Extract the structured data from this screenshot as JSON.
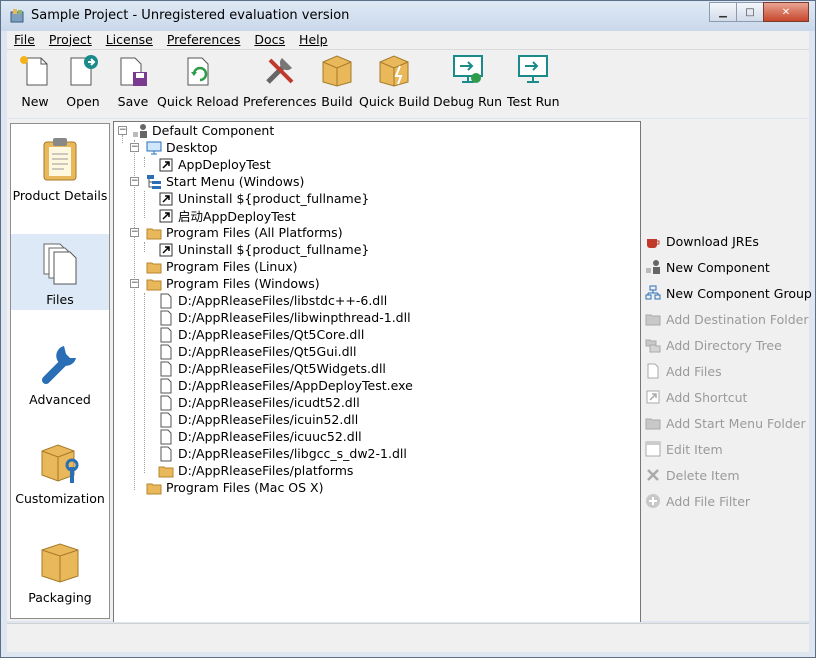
{
  "window": {
    "title": "Sample Project - Unregistered evaluation version",
    "controls": {
      "minimize": "▁",
      "maximize": "□",
      "close": "✕"
    }
  },
  "menu": [
    "File",
    "Project",
    "License",
    "Preferences",
    "Docs",
    "Help"
  ],
  "toolbar": [
    {
      "label": "New",
      "icon": "new-document-icon"
    },
    {
      "label": "Open",
      "icon": "open-document-icon"
    },
    {
      "label": "Save",
      "icon": "save-icon"
    },
    {
      "label": "Quick Reload",
      "icon": "reload-icon"
    },
    {
      "label": "Preferences",
      "icon": "tools-icon"
    },
    {
      "label": "Build",
      "icon": "box-icon"
    },
    {
      "label": "Quick Build",
      "icon": "quick-build-icon"
    },
    {
      "label": "Debug Run",
      "icon": "debug-run-icon"
    },
    {
      "label": "Test Run",
      "icon": "test-run-icon"
    }
  ],
  "nav": [
    {
      "label": "Product Details",
      "icon": "clipboard-icon",
      "active": false
    },
    {
      "label": "Files",
      "icon": "files-icon",
      "active": true
    },
    {
      "label": "Advanced",
      "icon": "wrench-icon",
      "active": false
    },
    {
      "label": "Customization",
      "icon": "box-wrench-icon",
      "active": false
    },
    {
      "label": "Packaging",
      "icon": "package-icon",
      "active": false
    }
  ],
  "tree": [
    {
      "text": "Default Component",
      "icon": "component-icon",
      "level": 0,
      "expanded": true
    },
    {
      "text": "Desktop",
      "icon": "monitor-icon",
      "level": 1,
      "expanded": true
    },
    {
      "text": "AppDeployTest",
      "icon": "shortcut-icon",
      "level": 2
    },
    {
      "text": "Start Menu (Windows)",
      "icon": "start-menu-icon",
      "level": 1,
      "expanded": true
    },
    {
      "text": "Uninstall ${product_fullname}",
      "icon": "shortcut-icon",
      "level": 2
    },
    {
      "text": "启动AppDeployTest",
      "icon": "shortcut-icon",
      "level": 2
    },
    {
      "text": "Program Files (All Platforms)",
      "icon": "folder-icon",
      "level": 1,
      "expanded": true
    },
    {
      "text": "Uninstall ${product_fullname}",
      "icon": "shortcut-icon",
      "level": 2
    },
    {
      "text": "Program Files (Linux)",
      "icon": "folder-icon",
      "level": 1
    },
    {
      "text": "Program Files (Windows)",
      "icon": "folder-icon",
      "level": 1,
      "expanded": true
    },
    {
      "text": "D:/AppRleaseFiles/libstdc++-6.dll",
      "icon": "file-icon",
      "level": 2
    },
    {
      "text": "D:/AppRleaseFiles/libwinpthread-1.dll",
      "icon": "file-icon",
      "level": 2
    },
    {
      "text": "D:/AppRleaseFiles/Qt5Core.dll",
      "icon": "file-icon",
      "level": 2
    },
    {
      "text": "D:/AppRleaseFiles/Qt5Gui.dll",
      "icon": "file-icon",
      "level": 2
    },
    {
      "text": "D:/AppRleaseFiles/Qt5Widgets.dll",
      "icon": "file-icon",
      "level": 2
    },
    {
      "text": "D:/AppRleaseFiles/AppDeployTest.exe",
      "icon": "file-icon",
      "level": 2
    },
    {
      "text": "D:/AppRleaseFiles/icudt52.dll",
      "icon": "file-icon",
      "level": 2
    },
    {
      "text": "D:/AppRleaseFiles/icuin52.dll",
      "icon": "file-icon",
      "level": 2
    },
    {
      "text": "D:/AppRleaseFiles/icuuc52.dll",
      "icon": "file-icon",
      "level": 2
    },
    {
      "text": "D:/AppRleaseFiles/libgcc_s_dw2-1.dll",
      "icon": "file-icon",
      "level": 2
    },
    {
      "text": "D:/AppRleaseFiles/platforms",
      "icon": "folder-icon",
      "level": 2
    },
    {
      "text": "Program Files (Mac OS X)",
      "icon": "folder-icon",
      "level": 1
    }
  ],
  "actions": [
    {
      "label": "Download JREs",
      "icon": "coffee-cup-icon",
      "enabled": true
    },
    {
      "label": "New Component",
      "icon": "component-icon",
      "enabled": true
    },
    {
      "label": "New Component Group",
      "icon": "component-group-icon",
      "enabled": true
    },
    {
      "label": "Add Destination Folder",
      "icon": "folder-icon",
      "enabled": false
    },
    {
      "label": "Add Directory Tree",
      "icon": "folder-tree-icon",
      "enabled": false
    },
    {
      "label": "Add Files",
      "icon": "file-icon",
      "enabled": false
    },
    {
      "label": "Add Shortcut",
      "icon": "shortcut-icon",
      "enabled": false
    },
    {
      "label": "Add Start Menu Folder",
      "icon": "folder-icon",
      "enabled": false
    },
    {
      "label": "Edit Item",
      "icon": "edit-icon",
      "enabled": false
    },
    {
      "label": "Delete Item",
      "icon": "delete-icon",
      "enabled": false
    },
    {
      "label": "Add File Filter",
      "icon": "add-icon",
      "enabled": false
    }
  ],
  "colors": {
    "folder": "#e8b85a",
    "accent": "#2a6fb5",
    "teal": "#1a8a8a"
  }
}
